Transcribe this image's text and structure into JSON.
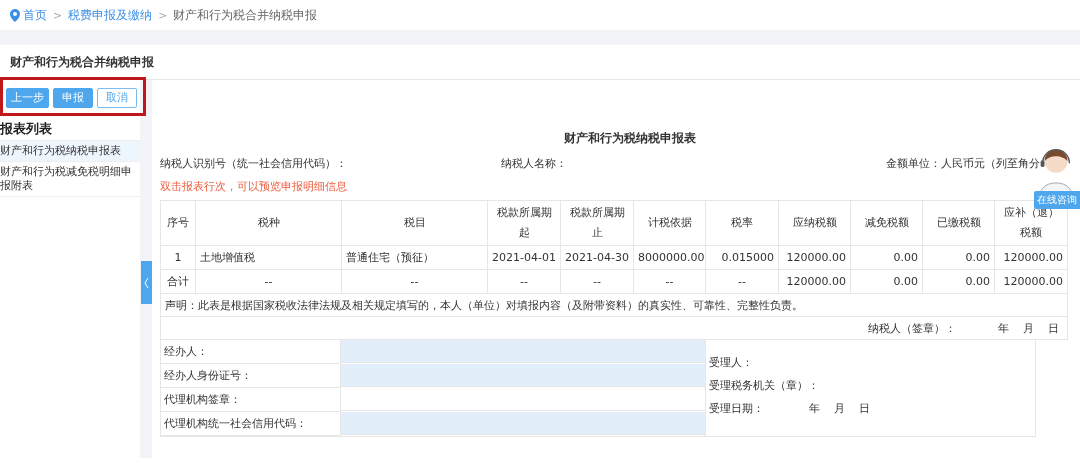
{
  "breadcrumb": [
    {
      "label": "首页",
      "kind": "home",
      "link": true
    },
    {
      "separator": ">",
      "label": "税费申报及缴纳",
      "kind": "page",
      "link": true
    },
    {
      "separator": ">",
      "label": "财产和行为税合并纳税申报",
      "kind": "page",
      "link": false
    }
  ],
  "page_title": "财产和行为税合并纳税申报",
  "toolbar": {
    "highlighted": true,
    "buttons": [
      {
        "label": "上一步",
        "kind": "primary"
      },
      {
        "label": "申报",
        "kind": "primary"
      },
      {
        "label": "取消",
        "kind": "outline"
      }
    ]
  },
  "sidebar": {
    "title": "报表列表",
    "items": [
      {
        "label": "财产和行为税纳税申报表",
        "selected": true
      },
      {
        "label": "财产和行为税减免税明细申报附表",
        "selected": false
      }
    ]
  },
  "form": {
    "title": "财产和行为税纳税申报表",
    "taxpayer_id_label": "纳税人识别号（统一社会信用代码）：",
    "taxpayer_name_label": "纳税人名称：",
    "currency_note": "金额单位：人民币元（列至角分",
    "hint": "双击报表行次，可以预览申报明细信息",
    "table": {
      "columns": [
        {
          "label": "序号",
          "kind": "index"
        },
        {
          "label": "税种",
          "kind": "text"
        },
        {
          "label": "税目",
          "kind": "text"
        },
        {
          "label": "税款所属期起",
          "kind": "date"
        },
        {
          "label": "税款所属期止",
          "kind": "date"
        },
        {
          "label": "计税依据",
          "kind": "number"
        },
        {
          "label": "税率",
          "kind": "number"
        },
        {
          "label": "应纳税额",
          "kind": "amount"
        },
        {
          "label": "减免税额",
          "kind": "amount"
        },
        {
          "label": "已缴税额",
          "kind": "amount"
        },
        {
          "label": "应补（退）税额",
          "kind": "amount"
        }
      ],
      "rows": [
        {
          "kind": "item",
          "cells": [
            "1",
            "土地增值税",
            "普通住宅（预征）",
            "2021-04-01",
            "2021-04-30",
            "8000000.00",
            "0.015000",
            "120000.00",
            "0.00",
            "0.00",
            "120000.00"
          ]
        },
        {
          "kind": "total",
          "cells": [
            "合计",
            "--",
            "--",
            "--",
            "--",
            "--",
            "--",
            "120000.00",
            "0.00",
            "0.00",
            "120000.00"
          ]
        }
      ]
    },
    "declaration": "声明：此表是根据国家税收法律法规及相关规定填写的，本人（单位）对填报内容（及附带资料）的真实性、可靠性、完整性负责。",
    "signature_label": "纳税人（签章）：",
    "signature_date": [
      "年",
      "月",
      "日"
    ],
    "agent_fields": [
      {
        "label": "经办人：",
        "editable": true
      },
      {
        "label": "经办人身份证号：",
        "editable": true
      },
      {
        "label": "代理机构签章：",
        "editable": false
      },
      {
        "label": "代理机构统一社会信用代码：",
        "editable": true
      }
    ],
    "acceptance": [
      "受理人：",
      "受理税务机关（章）：",
      "受理日期："
    ],
    "acceptance_date": [
      "年",
      "月",
      "日"
    ]
  },
  "support": {
    "label": "在线咨询"
  }
}
